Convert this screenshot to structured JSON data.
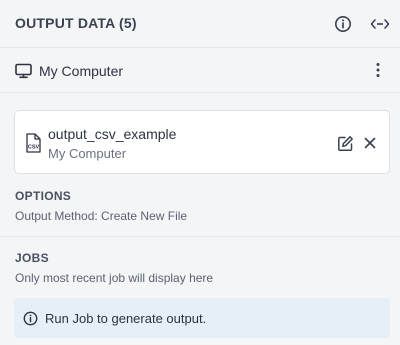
{
  "header": {
    "title": "OUTPUT DATA (5)",
    "info_icon": "info-circle-icon",
    "expand_icon": "arrows-horizontal-icon"
  },
  "source": {
    "label": "My Computer",
    "icon": "monitor-icon",
    "menu_icon": "more-vertical-icon"
  },
  "file": {
    "name": "output_csv_example",
    "location": "My Computer",
    "file_icon": "csv-file-icon",
    "file_icon_text": "CSV",
    "edit_icon": "edit-icon",
    "close_icon": "close-icon"
  },
  "options": {
    "title": "OPTIONS",
    "text": "Output Method: Create New File"
  },
  "jobs": {
    "title": "JOBS",
    "text": "Only most recent job will display here",
    "info_text": "Run Job to generate output.",
    "info_icon": "info-circle-icon"
  },
  "colors": {
    "info_background": "#e4eff8",
    "accent": "#3a4150"
  }
}
